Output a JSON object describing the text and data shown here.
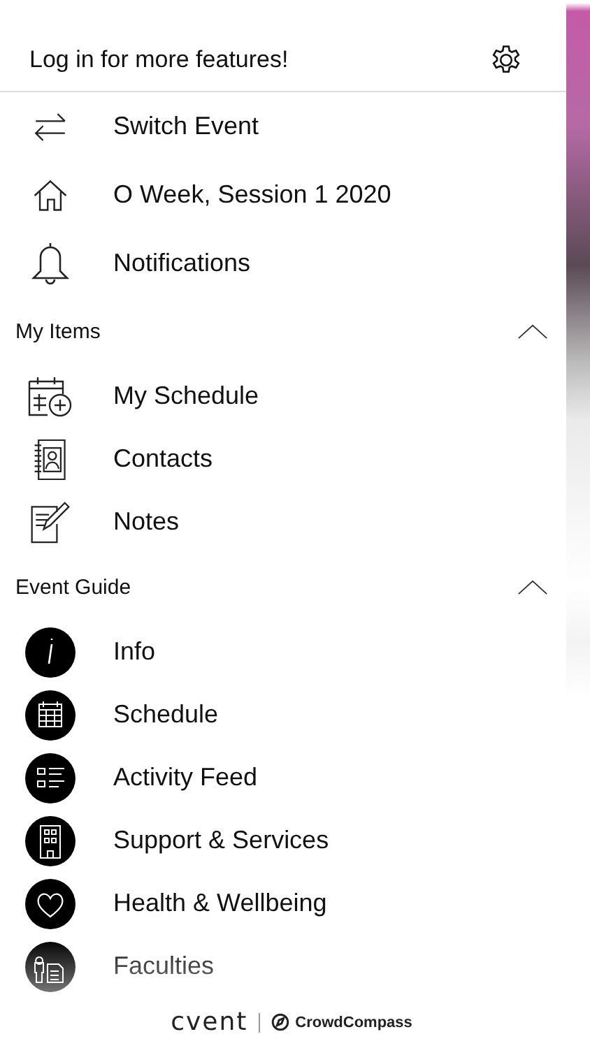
{
  "header": {
    "title": "Log in for more features!"
  },
  "top_items": [
    {
      "label": "Switch Event"
    },
    {
      "label": "O Week, Session 1 2020"
    },
    {
      "label": "Notifications"
    }
  ],
  "sections": [
    {
      "title": "My Items",
      "expanded": true,
      "items": [
        {
          "label": "My Schedule"
        },
        {
          "label": "Contacts"
        },
        {
          "label": "Notes"
        }
      ]
    },
    {
      "title": "Event Guide",
      "expanded": true,
      "items": [
        {
          "label": "Info"
        },
        {
          "label": "Schedule"
        },
        {
          "label": "Activity Feed"
        },
        {
          "label": "Support & Services"
        },
        {
          "label": "Health & Wellbeing"
        },
        {
          "label": "Faculties"
        }
      ]
    }
  ],
  "footer": {
    "brand": "cvent",
    "partner": "CrowdCompass"
  }
}
